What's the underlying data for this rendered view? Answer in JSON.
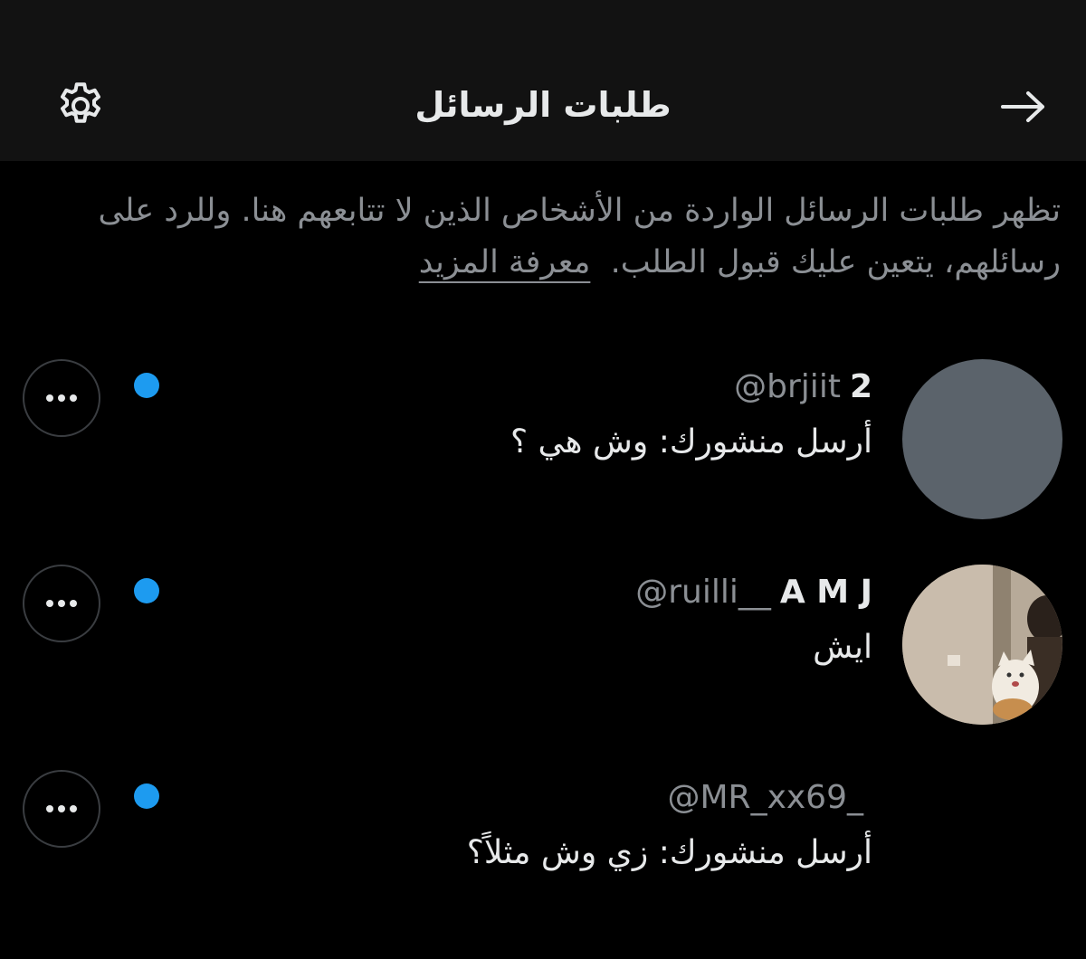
{
  "header": {
    "title": "طلبات الرسائل",
    "settings_icon": "gear-icon",
    "back_icon": "arrow-right-icon"
  },
  "info": {
    "text": "تظهر طلبات الرسائل الواردة من الأشخاص الذين لا تتابعهم هنا. وللرد على رسائلهم، يتعين عليك قبول الطلب.",
    "learn_more": "معرفة المزيد"
  },
  "colors": {
    "background": "#000000",
    "header_bg": "#121212",
    "unread_dot": "#1d9bf0",
    "secondary_text": "#8b8f94"
  },
  "requests": [
    {
      "display_name": "2",
      "handle": "@brjiit",
      "preview": "أرسل  منشورك: وش هي ؟",
      "unread": true,
      "avatar": "default-avatar"
    },
    {
      "display_name": "A M J",
      "handle": "@ruilli__",
      "preview": "ايش",
      "unread": true,
      "avatar": "photo-cat-avatar"
    },
    {
      "display_name": "",
      "handle": "@MR_xx69_",
      "preview": "أرسل  منشورك: زي وش مثلاً؟",
      "unread": true,
      "avatar": "none"
    }
  ]
}
